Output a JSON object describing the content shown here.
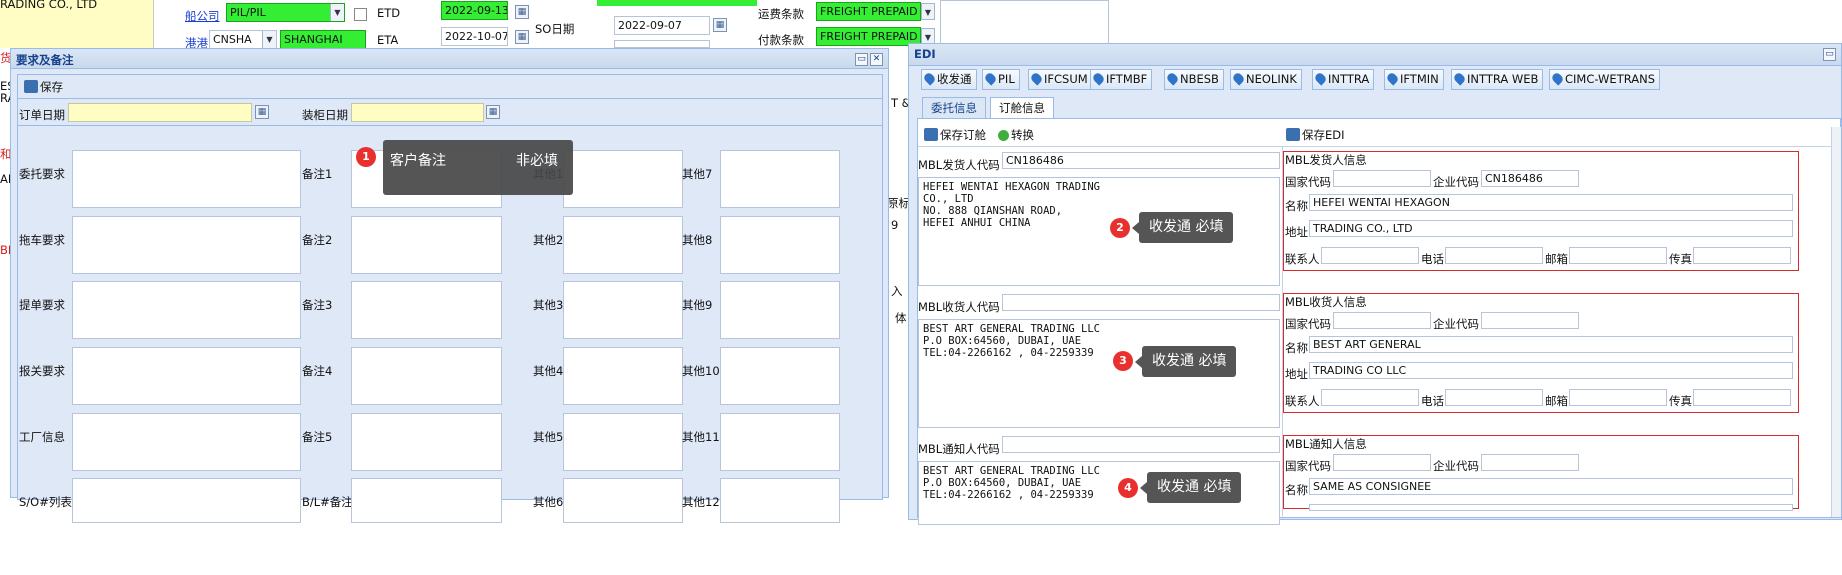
{
  "background_form": {
    "trading_co": "RADING CO., LTD",
    "carrier_label": "船公司",
    "carrier_value": "PIL/PIL",
    "etd_label": "ETD",
    "etd_value": "2022-09-13",
    "port_code_label": "港港",
    "port_code": "CNSHA",
    "port_name": "SHANGHAI",
    "eta_label": "ETA",
    "eta_value": "2022-10-07",
    "so_date_label": "SO日期",
    "so_date_value": "2022-09-07",
    "freight_terms_label": "运费条款",
    "freight_terms_value": "FREIGHT PREPAID",
    "payment_terms_label": "付款条款",
    "payment_terms_value": "FREIGHT PREPAID",
    "left_edge_text": [
      "货",
      "EST",
      "RA",
      "和",
      "AM",
      "BL"
    ],
    "right_edge_text": [
      "T &",
      "原标",
      "9",
      "入",
      "体"
    ]
  },
  "notes_panel": {
    "title": "要求及备注",
    "save_label": "保存",
    "order_date_label": "订单日期",
    "load_date_label": "装柜日期",
    "left_labels": [
      "委托要求",
      "拖车要求",
      "提单要求",
      "报关要求",
      "工厂信息",
      "S/O#列表"
    ],
    "mid_labels": [
      "备注1",
      "备注2",
      "备注3",
      "备注4",
      "备注5",
      "B/L#备注"
    ],
    "other_a_labels": [
      "其他1",
      "其他2",
      "其他3",
      "其他4",
      "其他5",
      "其他6"
    ],
    "other_b_labels": [
      "其他7",
      "其他8",
      "其他9",
      "其他10",
      "其他11",
      "其他12"
    ]
  },
  "edi_panel": {
    "title": "EDI",
    "buttons": [
      "收发通",
      "PIL",
      "IFCSUM",
      "IFTMBF",
      "NBESB",
      "NEOLINK",
      "INTTRA",
      "IFTMIN",
      "INTTRA WEB",
      "CIMC-WETRANS"
    ],
    "tabs": [
      "委托信息",
      "订舱信息"
    ],
    "active_tab": "订舱信息",
    "save_booking_label": "保存订舱",
    "convert_label": "转换",
    "save_edi_label": "保存EDI",
    "shipper": {
      "code_label": "MBL发货人代码",
      "code_value": "CN186486",
      "text": "HEFEI WENTAI HEXAGON TRADING\nCO., LTD\nNO. 888 QIANSHAN ROAD,\nHEFEI ANHUI CHINA",
      "info_title": "MBL发货人信息",
      "country_label": "国家代码",
      "country_value": "",
      "company_label": "企业代码",
      "company_value": "CN186486",
      "name_label": "名称",
      "name_value": "HEFEI WENTAI HEXAGON",
      "addr_label": "地址",
      "addr_value": "TRADING CO., LTD",
      "contact_label": "联系人",
      "phone_label": "电话",
      "email_label": "邮箱",
      "fax_label": "传真"
    },
    "consignee": {
      "code_label": "MBL收货人代码",
      "code_value": "",
      "text": "BEST ART GENERAL TRADING LLC\nP.O BOX:64560, DUBAI, UAE\nTEL:04-2266162 , 04-2259339",
      "info_title": "MBL收货人信息",
      "country_label": "国家代码",
      "company_label": "企业代码",
      "name_label": "名称",
      "name_value": "BEST ART GENERAL",
      "addr_label": "地址",
      "addr_value": "TRADING CO LLC",
      "contact_label": "联系人",
      "phone_label": "电话",
      "email_label": "邮箱",
      "fax_label": "传真"
    },
    "notify": {
      "code_label": "MBL通知人代码",
      "code_value": "",
      "text": "BEST ART GENERAL TRADING LLC\nP.O BOX:64560, DUBAI, UAE\nTEL:04-2266162 , 04-2259339",
      "info_title": "MBL通知人信息",
      "country_label": "国家代码",
      "company_label": "企业代码",
      "name_label": "名称",
      "name_value": "SAME AS CONSIGNEE"
    }
  },
  "annotations": [
    {
      "num": "1",
      "text": "客户备注",
      "extra": "非必填"
    },
    {
      "num": "2",
      "text": "收发通 必填"
    },
    {
      "num": "3",
      "text": "收发通 必填"
    },
    {
      "num": "4",
      "text": "收发通 必填"
    }
  ],
  "colors": {
    "required_green": "#33ee33",
    "date_yellow": "#fffcc4",
    "panel_bg": "#dfe8f6",
    "title_blue": "#15428b",
    "required_border": "#d92b2b",
    "callout_bg": "#464646",
    "badge_red": "#e8312e"
  }
}
